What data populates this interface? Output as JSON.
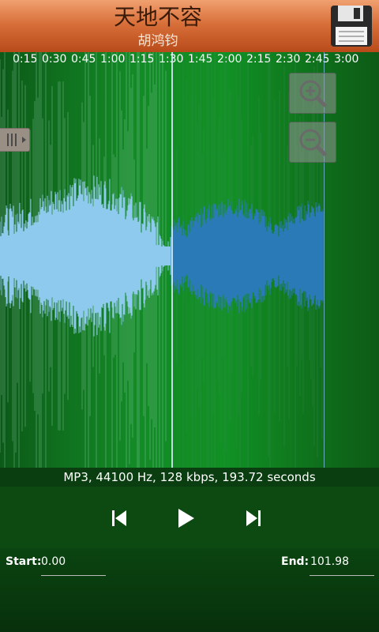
{
  "header": {
    "title": "天地不容",
    "artist": "胡鸿钧",
    "save_icon": "floppy-disk-icon"
  },
  "ruler": {
    "ticks": [
      "0:15",
      "0:30",
      "0:45",
      "1:00",
      "1:15",
      "1:30",
      "1:45",
      "2:00",
      "2:15",
      "2:30",
      "2:45",
      "3:00"
    ]
  },
  "zoom": {
    "zoom_in_icon": "zoom-in-icon",
    "zoom_out_icon": "zoom-out-icon"
  },
  "info": {
    "text": "MP3, 44100 Hz, 128 kbps, 193.72 seconds"
  },
  "controls": {
    "prev_icon": "skip-previous-icon",
    "play_icon": "play-icon",
    "next_icon": "skip-next-icon"
  },
  "selection": {
    "start_label": "Start:",
    "start_value": "0.00",
    "end_label": "End:",
    "end_value": "101.98"
  },
  "colors": {
    "header_orange": "#d8703a",
    "wave_selected": "#8ec9ee",
    "wave_unselected": "#2a7ab8",
    "background_green": "#138a26"
  }
}
